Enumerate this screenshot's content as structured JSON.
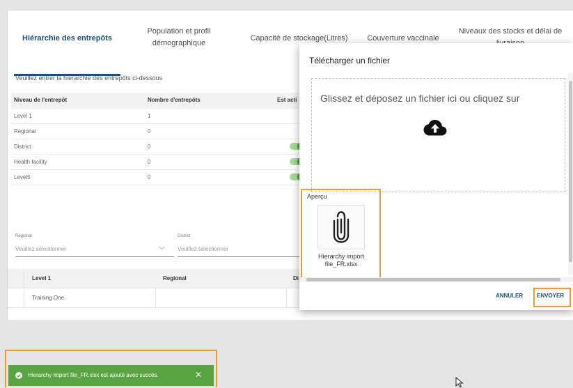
{
  "tabs": [
    {
      "label": "Hiérarchie des entrepôts",
      "active": true
    },
    {
      "label": "Population et profil démographique"
    },
    {
      "label": "Capacité de stockage(Litres)"
    },
    {
      "label": "Couverture vaccinale"
    },
    {
      "label": "Niveaux des stocks et délai de livraison"
    }
  ],
  "instructions": "Veuillez entrer la hiérarchie des entrepôts ci-dessous",
  "hierarchy_table": {
    "headers": [
      "Niveau de l'entrepôt",
      "Nombre d'entrepôts",
      "Est acti"
    ],
    "rows": [
      {
        "level": "Level 1",
        "count": "1",
        "active": false
      },
      {
        "level": "Regional",
        "count": "0",
        "active": false
      },
      {
        "level": "District",
        "count": "0",
        "active": true
      },
      {
        "level": "Health facility",
        "count": "0",
        "active": true
      },
      {
        "level": "Level5",
        "count": "0",
        "active": true
      }
    ]
  },
  "filters": {
    "regional": {
      "label": "Regional",
      "placeholder": "Veuillez sélectionner"
    },
    "district": {
      "label": "District",
      "placeholder": "Veuillez sélectionner"
    }
  },
  "lower_table": {
    "headers": [
      "Level 1",
      "Regional",
      "Di"
    ],
    "rows": [
      [
        "Training One",
        "",
        ""
      ]
    ]
  },
  "modal": {
    "title": "Télécharger un fichier",
    "dropzone_text": "Glissez et déposez un fichier ici ou cliquez sur",
    "preview_label": "Aperçu",
    "file_name": "Hierarchy import file_FR.xlsx",
    "cancel_label": "ANNULER",
    "send_label": "ENVOYER"
  },
  "toast": {
    "message": "Hierarchy import file_FR.xlsx est ajouté avec succès.",
    "close": "✕",
    "color": "#58a441"
  },
  "colors": {
    "primary": "#1d4f7c",
    "highlight": "#f39a2e",
    "toggle_on": "#36a61e"
  }
}
